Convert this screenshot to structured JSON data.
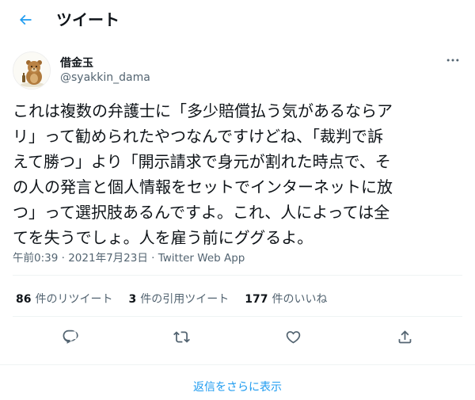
{
  "header": {
    "title": "ツイート",
    "back_icon": "arrow-left-icon",
    "accent": "#1d9bf0"
  },
  "author": {
    "display_name": "借金玉",
    "handle": "@syakkin_dama",
    "avatar_icon": "bear-avatar-icon",
    "more_icon": "more-horizontal-icon"
  },
  "tweet": {
    "text": "これは複数の弁護士に「多少賠償払う気があるならア\nリ」って勧められたやつなんですけどね、「裁判で訴\nえて勝つ」より「開示請求で身元が割れた時点で、そ\nの人の発言と個人情報をセットでインターネットに放\nつ」って選択肢あるんですよ。これ、人によっては全\nてを失うでしょ。人を雇う前にググるよ。",
    "time": "午前0:39",
    "sep1": "·",
    "date": "2021年7月23日",
    "sep2": "·",
    "source": "Twitter Web App"
  },
  "stats": [
    {
      "count": "86",
      "label": "件のリツイート"
    },
    {
      "count": "3",
      "label": "件の引用ツイート"
    },
    {
      "count": "177",
      "label": "件のいいね"
    }
  ],
  "actions": {
    "reply_icon": "reply-icon",
    "retweet_icon": "retweet-icon",
    "like_icon": "heart-icon",
    "share_icon": "share-icon",
    "icon_color": "#536471"
  },
  "footer": {
    "show_more_replies": "返信をさらに表示"
  }
}
